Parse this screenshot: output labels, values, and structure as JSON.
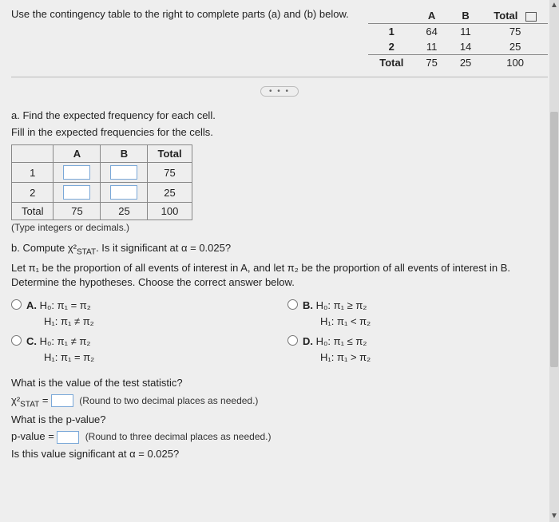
{
  "prompt": "Use the contingency table to the right to complete parts (a) and (b) below.",
  "contingency": {
    "col_headers": [
      "",
      "A",
      "B",
      "Total"
    ],
    "rows": [
      {
        "label": "1",
        "a": "64",
        "b": "11",
        "total": "75"
      },
      {
        "label": "2",
        "a": "11",
        "b": "14",
        "total": "25"
      },
      {
        "label": "Total",
        "a": "75",
        "b": "25",
        "total": "100"
      }
    ]
  },
  "ellipsis": "• • •",
  "part_a": {
    "title": "a. Find the expected frequency for each cell.",
    "subtitle": "Fill in the expected frequencies for the cells.",
    "table": {
      "headers": [
        "",
        "A",
        "B",
        "Total"
      ],
      "row1": {
        "label": "1",
        "total": "75"
      },
      "row2": {
        "label": "2",
        "total": "25"
      },
      "row_total": {
        "label": "Total",
        "a": "75",
        "b": "25",
        "total": "100"
      }
    },
    "hint": "(Type integers or decimals.)"
  },
  "part_b": {
    "title_prefix": "b. Compute ",
    "title_stat": "χ²",
    "title_stat_sub": "STAT",
    "title_suffix": ". Is it significant at α = 0.025?",
    "hypothesis_intro": "Let π₁ be the proportion of all events of interest in A, and let π₂ be the proportion of all events of interest in B. Determine the hypotheses. Choose the correct answer below.",
    "options": {
      "A": {
        "letter": "A.",
        "h0": "H₀: π₁ = π₂",
        "h1": "H₁: π₁ ≠ π₂"
      },
      "B": {
        "letter": "B.",
        "h0": "H₀: π₁ ≥ π₂",
        "h1": "H₁: π₁ < π₂"
      },
      "C": {
        "letter": "C.",
        "h0": "H₀: π₁ ≠ π₂",
        "h1": "H₁: π₁ = π₂"
      },
      "D": {
        "letter": "D.",
        "h0": "H₀: π₁ ≤ π₂",
        "h1": "H₁: π₁ > π₂"
      }
    },
    "test_stat_q": "What is the value of the test statistic?",
    "test_stat_label_prefix": "χ²",
    "test_stat_label_sub": "STAT",
    "test_stat_equals": " = ",
    "test_stat_hint": "(Round to two decimal places as needed.)",
    "pvalue_q": "What is the p-value?",
    "pvalue_label": "p-value = ",
    "pvalue_hint": "(Round to three decimal places as needed.)",
    "significance_q": "Is this value significant at α = 0.025?"
  }
}
